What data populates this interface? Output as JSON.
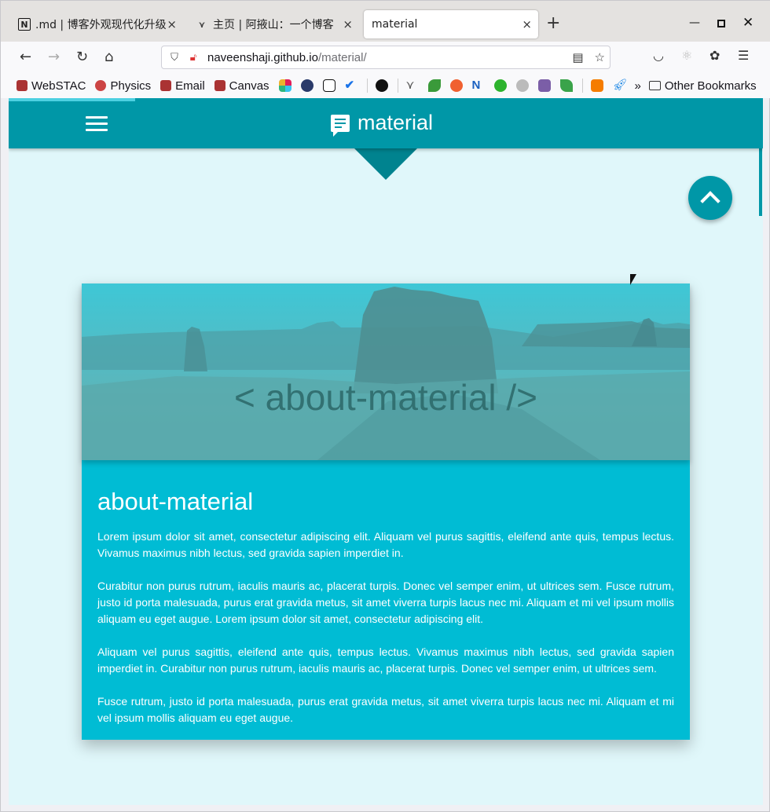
{
  "browser": {
    "tabs": [
      {
        "label": ".md | 博客外观现代化升级",
        "icon": "notion-icon"
      },
      {
        "label": "主页 | 阿掖山：一个博客",
        "icon": "blog-icon"
      },
      {
        "label": "material",
        "icon": ""
      }
    ],
    "url_host": "naveenshaji.github.io",
    "url_path": "/material/",
    "bookmarks": [
      "WebSTAC",
      "Physics",
      "Email",
      "Canvas"
    ],
    "other_bookmarks": "Other Bookmarks"
  },
  "page": {
    "brand": "material",
    "hero_title": "< about-material />",
    "card_title": "about-material",
    "paragraphs": [
      "Lorem ipsum dolor sit amet, consectetur adipiscing elit. Aliquam vel purus sagittis, eleifend ante quis, tempus lectus. Vivamus maximus nibh lectus, sed gravida sapien imperdiet in.",
      "Curabitur non purus rutrum, iaculis mauris ac, placerat turpis. Donec vel semper enim, ut ultrices sem. Fusce rutrum, justo id porta malesuada, purus erat gravida metus, sit amet viverra turpis lacus nec mi. Aliquam et mi vel ipsum mollis aliquam eu eget augue. Lorem ipsum dolor sit amet, consectetur adipiscing elit.",
      "Aliquam vel purus sagittis, eleifend ante quis, tempus lectus. Vivamus maximus nibh lectus, sed gravida sapien imperdiet in. Curabitur non purus rutrum, iaculis mauris ac, placerat turpis. Donec vel semper enim, ut ultrices sem.",
      "Fusce rutrum, justo id porta malesuada, purus erat gravida metus, sit amet viverra turpis lacus nec mi. Aliquam et mi vel ipsum mollis aliquam eu eget augue."
    ],
    "colors": {
      "primary": "#0097a7",
      "card": "#00bcd4",
      "background": "#e0f7fa"
    }
  }
}
